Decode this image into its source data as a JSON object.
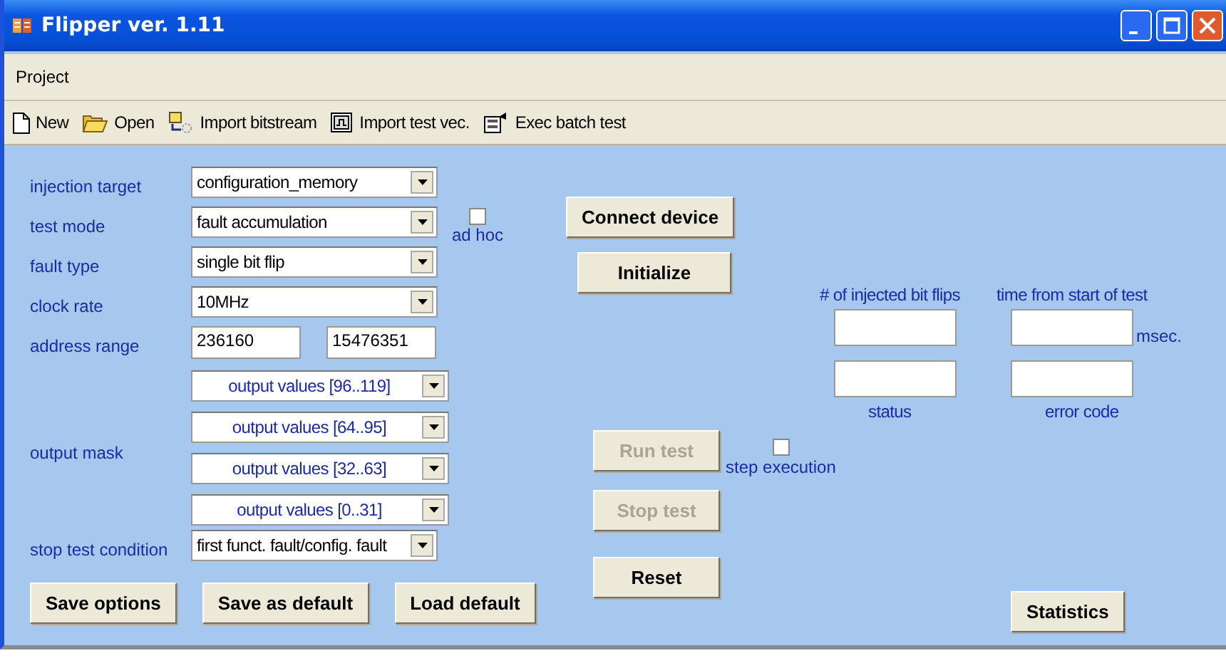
{
  "window": {
    "title": "Flipper ver. 1.11"
  },
  "menu": [
    "Project"
  ],
  "toolbar": [
    {
      "kind": "new",
      "label": "New"
    },
    {
      "kind": "open",
      "label": "Open"
    },
    {
      "kind": "bitstream",
      "label": "Import bitstream"
    },
    {
      "kind": "testvec",
      "label": "Import test vec."
    },
    {
      "kind": "batch",
      "label": "Exec batch test"
    }
  ],
  "settings": [
    {
      "kind": "dropdown",
      "label": "injection target",
      "value": "configuration_memory"
    },
    {
      "kind": "dropdown",
      "label": "test mode",
      "value": "fault accumulation",
      "option": {
        "label": "ad hoc",
        "checked": false
      }
    },
    {
      "kind": "dropdown",
      "label": "fault type",
      "value": "single bit flip"
    },
    {
      "kind": "dropdown",
      "label": "clock rate",
      "value": "10MHz"
    },
    {
      "kind": "range",
      "label": "address range",
      "values": [
        "236160",
        "15476351"
      ]
    },
    {
      "kind": "mask",
      "label": "output mask",
      "values": [
        "output values [96..119]",
        "output values [64..95]",
        "output values [32..63]",
        "output values [0..31]"
      ]
    },
    {
      "kind": "dropdown",
      "label": "stop test condition",
      "value": "first funct. fault/config. fault"
    }
  ],
  "option_buttons": [
    "Save options",
    "Save as default",
    "Load default"
  ],
  "device_buttons": [
    {
      "label": "Connect device",
      "disabled": false
    },
    {
      "label": "Initialize",
      "disabled": false
    }
  ],
  "test_buttons": [
    {
      "label": "Run test",
      "disabled": true
    },
    {
      "label": "Stop test",
      "disabled": true
    },
    {
      "label": "Reset",
      "disabled": false
    }
  ],
  "step_execution": {
    "label": "step execution",
    "checked": false
  },
  "counters": [
    {
      "label": "# of injected bit flips"
    },
    {
      "label": "time from start of test",
      "unit": "msec."
    }
  ],
  "status_fields": [
    {
      "label": "status"
    },
    {
      "label": "error code"
    }
  ],
  "statistics_button": {
    "label": "Statistics",
    "disabled": false
  }
}
